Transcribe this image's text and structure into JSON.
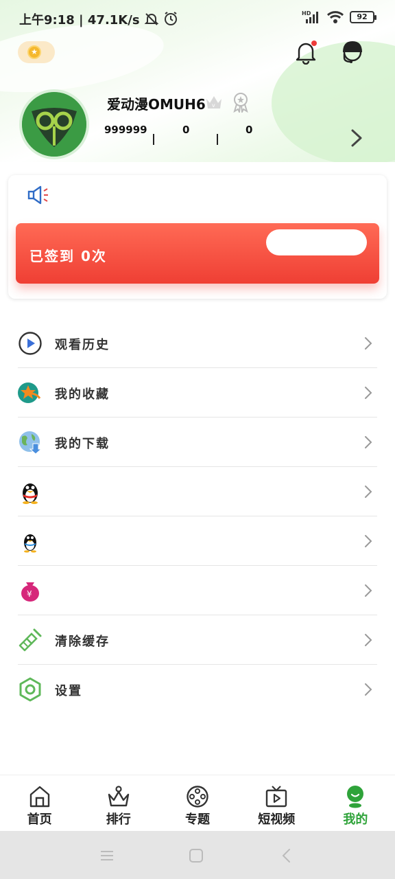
{
  "status_bar": {
    "time": "上午9:18",
    "speed": "47.1K/s",
    "battery": "92",
    "network": "HD"
  },
  "header": {
    "coin_icon": "coin-icon",
    "bell_icon": "bell-icon",
    "service_icon": "customer-service-icon"
  },
  "profile": {
    "username": "爱动漫OMUH6",
    "stats": [
      "999999",
      "0",
      "0"
    ]
  },
  "signin": {
    "text": "已签到 0次",
    "button_label": ""
  },
  "menu": {
    "items": [
      {
        "label": "观看历史",
        "icon": "play-circle-icon"
      },
      {
        "label": "我的收藏",
        "icon": "star-icon"
      },
      {
        "label": "我的下载",
        "icon": "download-globe-icon"
      },
      {
        "label": "",
        "icon": "qq-penguin-icon"
      },
      {
        "label": "",
        "icon": "qq-penguin-small-icon"
      },
      {
        "label": "",
        "icon": "money-bag-icon"
      },
      {
        "label": "清除缓存",
        "icon": "broom-icon"
      },
      {
        "label": "设置",
        "icon": "settings-icon"
      }
    ]
  },
  "tabs": [
    {
      "label": "首页",
      "icon": "home-icon"
    },
    {
      "label": "排行",
      "icon": "ranking-icon"
    },
    {
      "label": "专题",
      "icon": "film-reel-icon"
    },
    {
      "label": "短视频",
      "icon": "tv-play-icon"
    },
    {
      "label": "我的",
      "icon": "profile-icon"
    }
  ],
  "colors": {
    "accent_green": "#2fa33a",
    "signin_red": "#ef3f34",
    "speaker_blue": "#2e6bc6"
  }
}
